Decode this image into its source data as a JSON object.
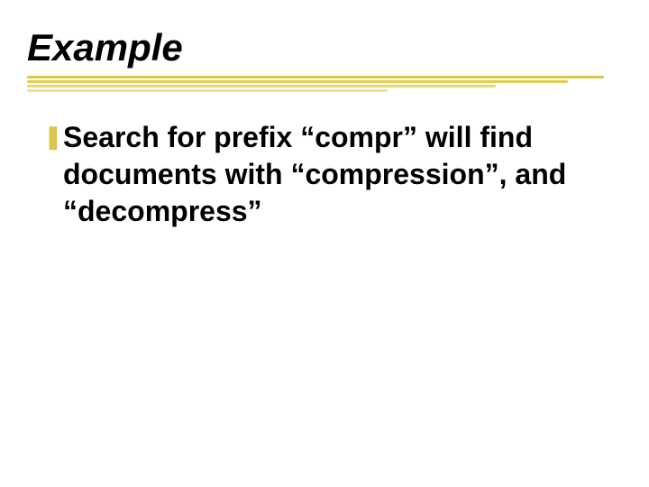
{
  "slide": {
    "title": "Example",
    "bullets": [
      {
        "text": "Search for  prefix “compr” will find documents with “compression”,  and “decompress”"
      }
    ]
  },
  "colors": {
    "accent": "#d9c64a"
  }
}
